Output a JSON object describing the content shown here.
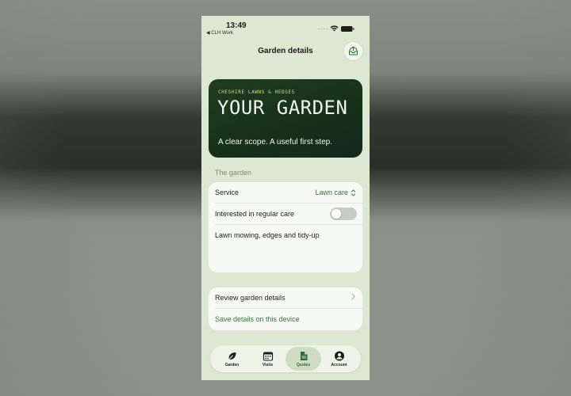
{
  "status_bar": {
    "time": "13:49",
    "back_label": "◀ CLH Work",
    "dots": "····"
  },
  "header": {
    "title": "Garden details",
    "share_icon": "tray-arrow-up-icon"
  },
  "hero": {
    "eyebrow": "CHESHIRE LAWNS & HEDGES",
    "title": "YOUR GARDEN",
    "tagline": "A clear scope. A useful first step."
  },
  "garden_section": {
    "label": "The garden",
    "service": {
      "label": "Service",
      "value": "Lawn care",
      "icon": "chevron-up-down-icon"
    },
    "regular_care": {
      "label": "Interested in regular care",
      "enabled": false
    },
    "note": "Lawn mowing, edges and tidy-up"
  },
  "actions": {
    "review": "Review garden details",
    "save": "Save details on this device"
  },
  "tabs": [
    {
      "label": "Garden",
      "icon": "leaf-icon",
      "active": false
    },
    {
      "label": "Visits",
      "icon": "calendar-icon",
      "active": false
    },
    {
      "label": "Quotes",
      "icon": "document-icon",
      "active": true
    },
    {
      "label": "Account",
      "icon": "person-circle-icon",
      "active": false
    }
  ],
  "colors": {
    "accent": "#2f7a3a",
    "background": "#dce8d2",
    "hero": "#16301a",
    "eyebrow": "#c8e06a"
  }
}
